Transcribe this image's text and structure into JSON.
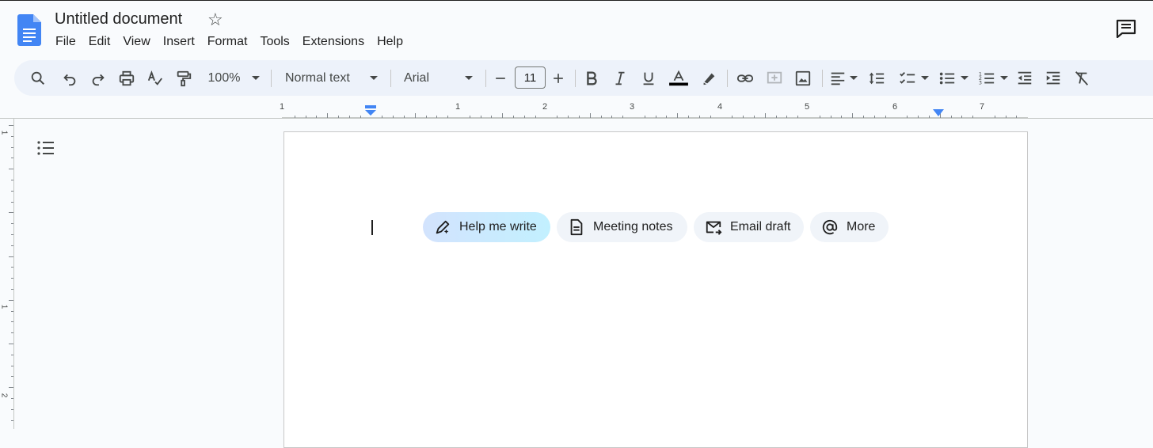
{
  "header": {
    "title": "Untitled document",
    "menu": [
      "File",
      "Edit",
      "View",
      "Insert",
      "Format",
      "Tools",
      "Extensions",
      "Help"
    ]
  },
  "toolbar": {
    "zoom": "100%",
    "style": "Normal text",
    "font": "Arial",
    "font_size": "11"
  },
  "ruler": {
    "labels": [
      "1",
      "1",
      "2",
      "3",
      "4",
      "5",
      "6",
      "7"
    ],
    "vertical_labels": [
      "1",
      "1",
      "2"
    ]
  },
  "chips": {
    "help_me_write": "Help me write",
    "meeting_notes": "Meeting notes",
    "email_draft": "Email draft",
    "more": "More"
  },
  "colors": {
    "accent": "#1a73e8",
    "toolbar_bg": "#edf2fa",
    "chip_bg": "#f0f4f9"
  }
}
